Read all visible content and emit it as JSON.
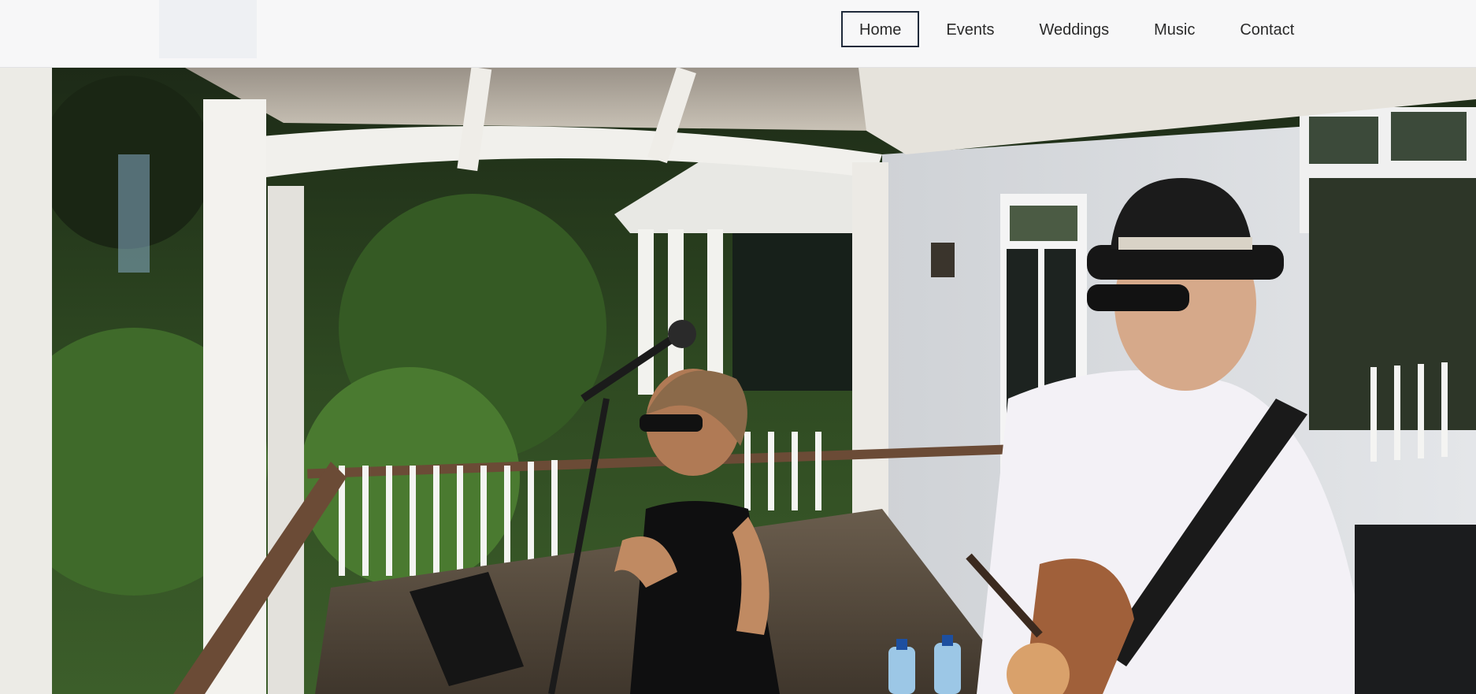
{
  "header": {
    "nav": [
      {
        "label": "Home",
        "active": true
      },
      {
        "label": "Events",
        "active": false
      },
      {
        "label": "Weddings",
        "active": false
      },
      {
        "label": "Music",
        "active": false
      },
      {
        "label": "Contact",
        "active": false
      }
    ]
  },
  "hero": {
    "scene": "two-musicians-on-veranda-photo"
  },
  "colors": {
    "header_bg": "#f7f7f8",
    "nav_text": "#2a2a2a",
    "nav_active_border": "#1f2a3a"
  }
}
